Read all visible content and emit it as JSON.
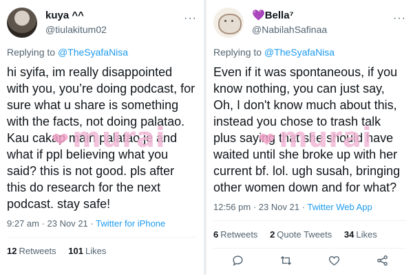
{
  "left": {
    "name": "kuya ^^",
    "handle": "@tiulakitum02",
    "replying_prefix": "Replying to ",
    "replying_to": "@TheSyafaNisa",
    "text": "hi syifa, im really disappointed with you, you’re doing podcast, for sure what u share is something with the facts, not doing palatao. Kau cakap main palatao je and what if ppl believing what you said? this is not good. pls after this do research for the next podcast. stay safe!",
    "timestamp": "9:27 am · 23 Nov 21 · ",
    "source": "Twitter for iPhone",
    "retweets_count": "12",
    "retweets_label": "Retweets",
    "likes_count": "101",
    "likes_label": "Likes"
  },
  "right": {
    "name_emoji": "💜",
    "name": "Bella⁷",
    "handle": "@NabilahSafinaa",
    "replying_prefix": "Replying to ",
    "replying_to": "@TheSyafaNisa",
    "text": "Even if it was spontaneous, if you know nothing, you can just say, Oh, I don't know much about this, instead you chose to trash talk plus saying that she should have waited until she broke up with her current bf. lol. ugh susah, bringing other women down and for what?",
    "timestamp": "12:56 pm · 23 Nov 21 · ",
    "source": "Twitter Web App",
    "retweets_count": "6",
    "retweets_label": "Retweets",
    "quotes_count": "2",
    "quotes_label": "Quote Tweets",
    "likes_count": "34",
    "likes_label": "Likes"
  },
  "watermark": "murai",
  "colors": {
    "link": "#1d9bf0",
    "muted": "#536471",
    "watermark": "#f2b8d6"
  },
  "icons": [
    "more-icon",
    "reply-icon",
    "retweet-icon",
    "like-icon",
    "share-icon"
  ]
}
